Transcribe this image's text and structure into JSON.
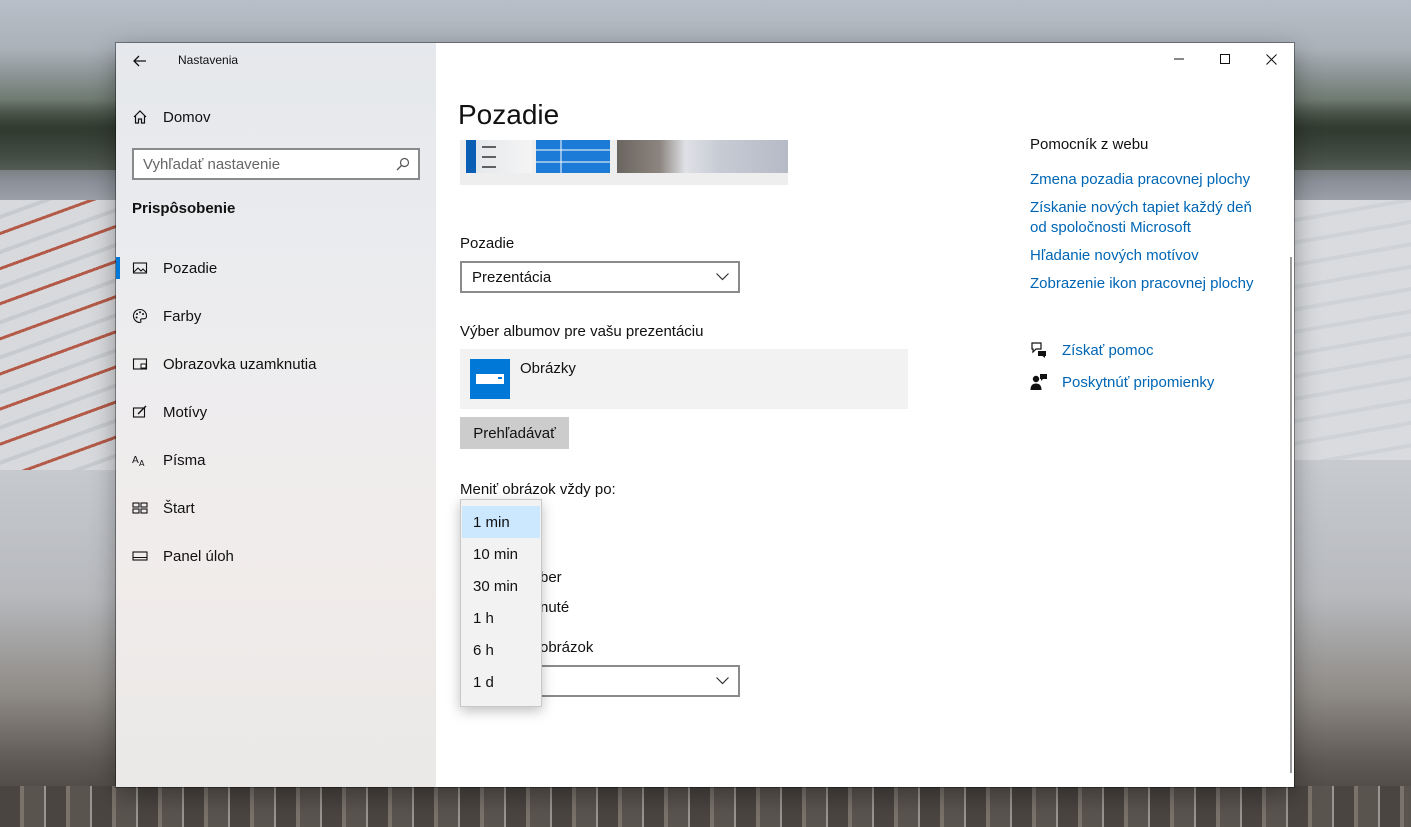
{
  "window": {
    "title": "Nastavenia"
  },
  "sidebar": {
    "home_label": "Domov",
    "search_placeholder": "Vyhľadať nastavenie",
    "section_header": "Prispôsobenie",
    "items": [
      {
        "label": "Pozadie",
        "icon": "picture-icon",
        "active": true
      },
      {
        "label": "Farby",
        "icon": "palette-icon",
        "active": false
      },
      {
        "label": "Obrazovka uzamknutia",
        "icon": "lock-screen-icon",
        "active": false
      },
      {
        "label": "Motívy",
        "icon": "themes-icon",
        "active": false
      },
      {
        "label": "Písma",
        "icon": "fonts-icon",
        "active": false
      },
      {
        "label": "Štart",
        "icon": "start-icon",
        "active": false
      },
      {
        "label": "Panel úloh",
        "icon": "taskbar-icon",
        "active": false
      }
    ]
  },
  "main": {
    "title": "Pozadie",
    "background_label": "Pozadie",
    "background_value": "Prezentácia",
    "album_label": "Výber albumov pre vašu prezentáciu",
    "album_name": "Obrázky",
    "browse_label": "Prehľadávať",
    "change_label": "Meniť obrázok vždy po:",
    "interval_options": [
      "1 min",
      "10 min",
      "30 min",
      "1 h",
      "6 h",
      "1 d"
    ],
    "interval_selected": "1 min",
    "partial_shuffle": "ber",
    "partial_battery": "nuté",
    "partial_fit": "obrázok"
  },
  "help": {
    "header": "Pomocník z webu",
    "links": [
      "Zmena pozadia pracovnej plochy",
      "Získanie nových tapiet každý deň od spoločnosti Microsoft",
      "Hľadanie nových motívov",
      "Zobrazenie ikon pracovnej plochy"
    ],
    "get_help": "Získať pomoc",
    "feedback": "Poskytnúť pripomienky"
  },
  "colors": {
    "accent": "#0078d7",
    "link": "#0066b4",
    "selection": "#cce8ff"
  }
}
